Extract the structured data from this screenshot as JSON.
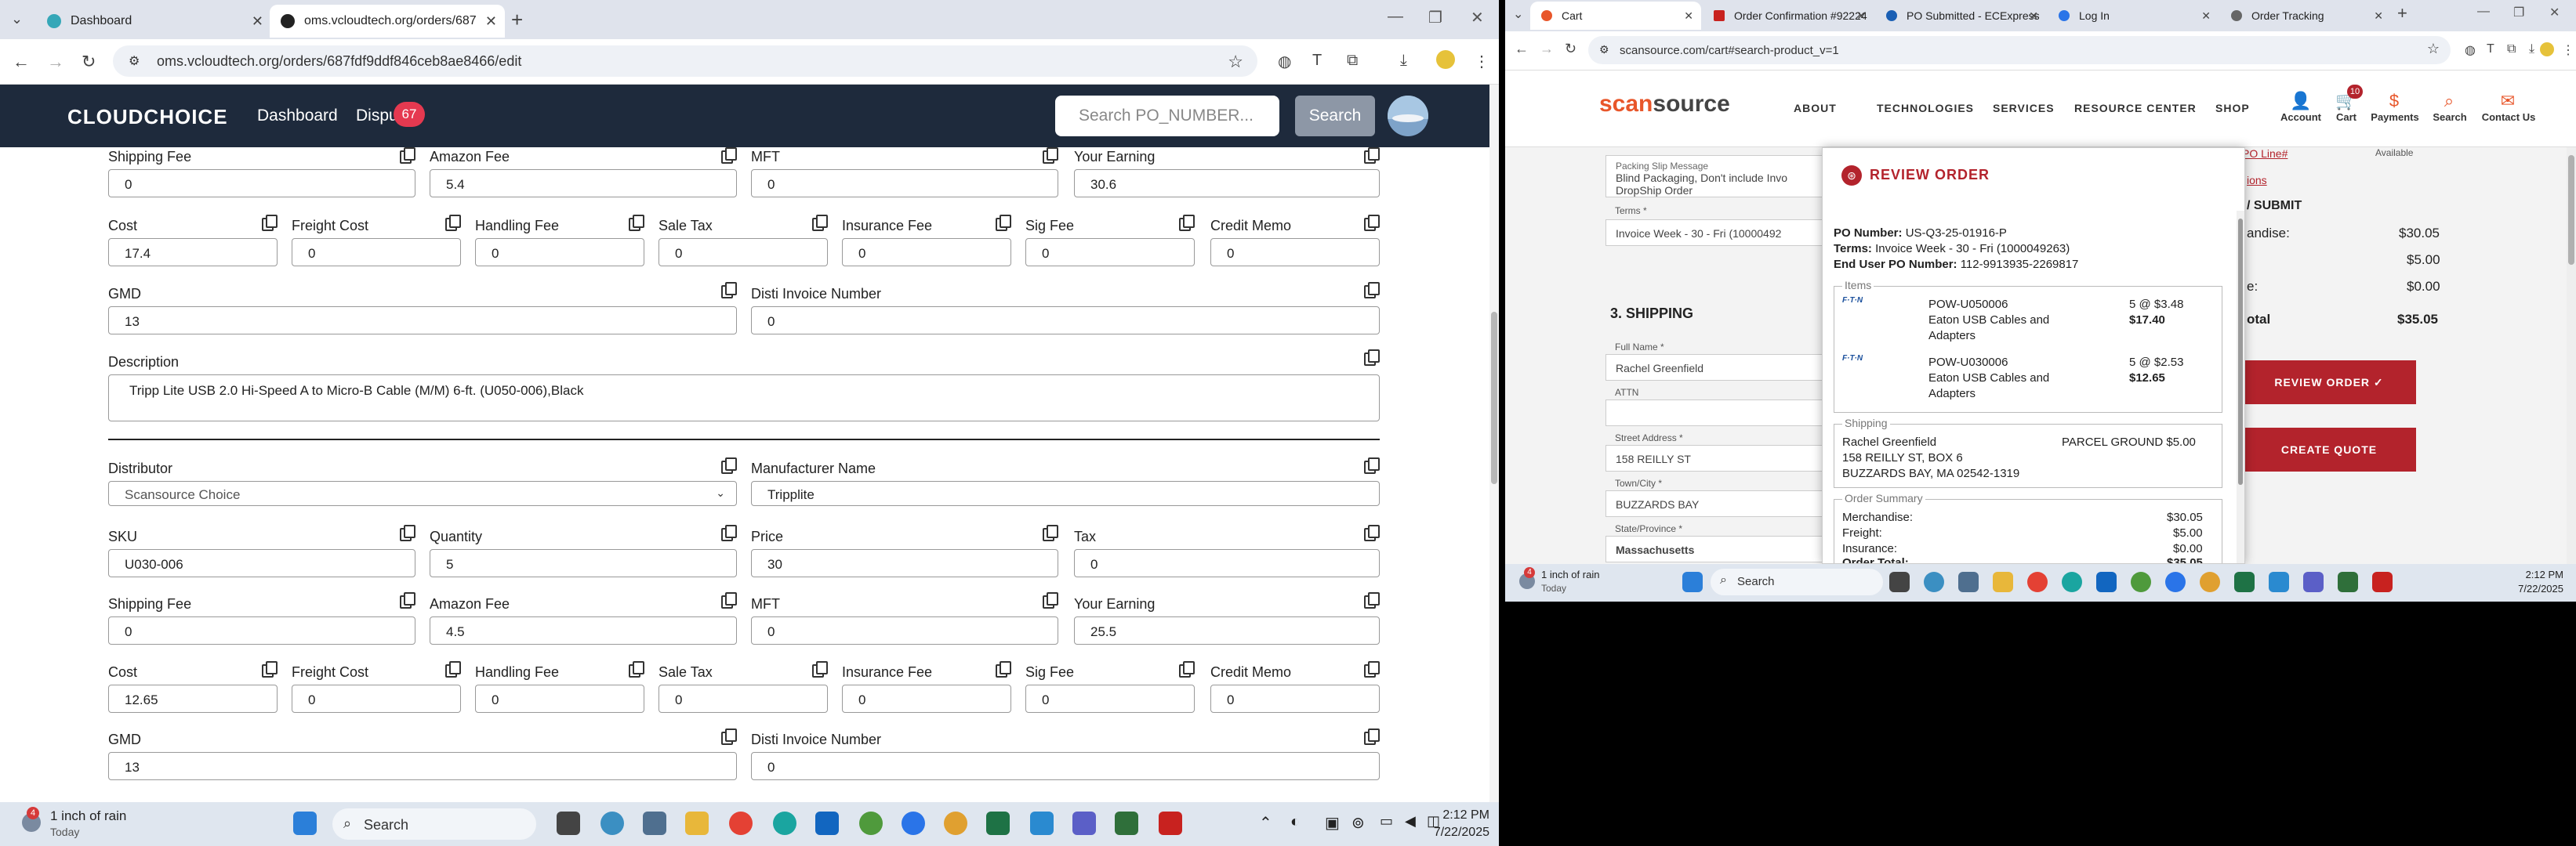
{
  "left": {
    "tabs": [
      {
        "label": "Dashboard",
        "color": "#35a7b8"
      },
      {
        "label": "oms.vcloudtech.org/orders/687",
        "color": "#222222"
      }
    ],
    "url": "oms.vcloudtech.org/orders/687fdf9ddf846ceb8ae8466/edit",
    "app": {
      "logo": "CLOUDCHOICE",
      "menu": [
        "Dashboard",
        "Dispu"
      ],
      "badge": "67",
      "search_placeholder": "Search PO_NUMBER...",
      "search_button": "Search"
    },
    "form": {
      "item1": {
        "shipping_fee": "Shipping Fee",
        "shipping_fee_val": "0",
        "amazon_fee": "Amazon Fee",
        "amazon_fee_val": "5.4",
        "mft": "MFT",
        "mft_val": "0",
        "your_earning": "Your Earning",
        "your_earning_val": "30.6",
        "cost": "Cost",
        "cost_val": "17.4",
        "freight_cost": "Freight Cost",
        "freight_cost_val": "0",
        "handling_fee": "Handling Fee",
        "handling_fee_val": "0",
        "sale_tax": "Sale Tax",
        "sale_tax_val": "0",
        "insurance_fee": "Insurance Fee",
        "insurance_fee_val": "0",
        "sig_fee": "Sig Fee",
        "sig_fee_val": "0",
        "credit_memo": "Credit Memo",
        "credit_memo_val": "0",
        "gmd": "GMD",
        "gmd_val": "13",
        "disti_invoice": "Disti Invoice Number",
        "disti_invoice_val": "0",
        "description": "Description",
        "description_val": "Tripp Lite USB 2.0 Hi-Speed A to Micro-B Cable (M/M) 6-ft. (U050-006),Black"
      },
      "item2": {
        "distributor": "Distributor",
        "distributor_val": "Scansource Choice",
        "manufacturer": "Manufacturer Name",
        "manufacturer_val": "Tripplite",
        "sku": "SKU",
        "sku_val": "U030-006",
        "quantity": "Quantity",
        "quantity_val": "5",
        "price": "Price",
        "price_val": "30",
        "tax": "Tax",
        "tax_val": "0",
        "shipping_fee": "Shipping Fee",
        "shipping_fee_val": "0",
        "amazon_fee": "Amazon Fee",
        "amazon_fee_val": "4.5",
        "mft": "MFT",
        "mft_val": "0",
        "your_earning": "Your Earning",
        "your_earning_val": "25.5",
        "cost": "Cost",
        "cost_val": "12.65",
        "freight_cost": "Freight Cost",
        "freight_cost_val": "0",
        "handling_fee": "Handling Fee",
        "handling_fee_val": "0",
        "sale_tax": "Sale Tax",
        "sale_tax_val": "0",
        "insurance_fee": "Insurance Fee",
        "insurance_fee_val": "0",
        "sig_fee": "Sig Fee",
        "sig_fee_val": "0",
        "credit_memo": "Credit Memo",
        "credit_memo_val": "0",
        "gmd": "GMD",
        "gmd_val": "13",
        "disti_invoice": "Disti Invoice Number",
        "disti_invoice_val": "0"
      }
    },
    "taskbar": {
      "weather_badge": "4",
      "weather": "1 inch of rain",
      "weather_sub": "Today",
      "search": "Search",
      "time": "2:12 PM",
      "date": "7/22/2025"
    }
  },
  "right": {
    "tabs": [
      "Cart",
      "Order Confirmation #92224",
      "PO Submitted - ECExpress",
      "Log In",
      "Order Tracking"
    ],
    "url": "scansource.com/cart#search-product_v=1",
    "site": {
      "logo_a": "scan",
      "logo_b": "source",
      "nav": [
        "ABOUT",
        "TECHNOLOGIES",
        "SERVICES",
        "RESOURCE CENTER",
        "SHOP"
      ],
      "icons": [
        "Account",
        "Cart",
        "Payments",
        "Search",
        "Contact Us"
      ],
      "cart_count": "10"
    },
    "bg": {
      "packing_label": "Packing Slip Message",
      "packing_text": "Blind Packaging, Don't include Invo",
      "packing_text2": "DropShip Order",
      "dropship": "DropShip",
      "terms_label": "Terms *",
      "terms_val": "Invoice Week - 30 - Fri (10000492",
      "po_line": "PO Line#",
      "available": "Available",
      "options": "ions",
      "submit": "/ SUBMIT",
      "shipping": "3. SHIPPING",
      "full_name_label": "Full Name *",
      "full_name_val": "Rachel Greenfield",
      "attn_label": "ATTN",
      "street_label": "Street Address *",
      "street_val": "158 REILLY ST",
      "town_label": "Town/City *",
      "town_val": "BUZZARDS BAY",
      "state_label": "State/Province *",
      "state_val": "Massachusetts",
      "sum_merch_label": "andise:",
      "sum_merch": "$30.05",
      "sum_freight": "$5.00",
      "sum_ins_label": "e:",
      "sum_ins": "$0.00",
      "sum_total_label": "otal",
      "sum_total": "$35.05",
      "review_btn": "REVIEW ORDER ✓",
      "quote_btn": "CREATE QUOTE"
    },
    "modal": {
      "title": "REVIEW ORDER",
      "po_label": "PO Number:",
      "po": "US-Q3-25-01916-P",
      "terms_label": "Terms:",
      "terms": "Invoice Week - 30 - Fri (1000049263)",
      "enduser_label": "End User PO Number:",
      "enduser": "112-9913935-2269817",
      "items_label": "Items",
      "items": [
        {
          "brand": "F·T·N",
          "sku": "POW-U050006",
          "name": "Eaton USB Cables and",
          "name2": "Adapters",
          "qty": "5 @ $3.48",
          "total": "$17.40"
        },
        {
          "brand": "F·T·N",
          "sku": "POW-U030006",
          "name": "Eaton USB Cables and",
          "name2": "Adapters",
          "qty": "5 @ $2.53",
          "total": "$12.65"
        }
      ],
      "shipping_label": "Shipping",
      "ship_name": "Rachel Greenfield",
      "ship_method": "PARCEL GROUND $5.00",
      "ship_addr1": "158 REILLY ST, BOX 6",
      "ship_addr2": "BUZZARDS BAY, MA 02542-1319",
      "summary_label": "Order Summary",
      "merch_label": "Merchandise:",
      "merch": "$30.05",
      "freight_label": "Freight:",
      "freight": "$5.00",
      "ins_label": "Insurance:",
      "ins": "$0.00",
      "total_label": "Order Total:",
      "total": "$35.05"
    },
    "taskbar": {
      "weather_badge": "4",
      "weather": "1 inch of rain",
      "weather_sub": "Today",
      "search": "Search",
      "time": "2:12 PM",
      "date": "7/22/2025"
    }
  }
}
